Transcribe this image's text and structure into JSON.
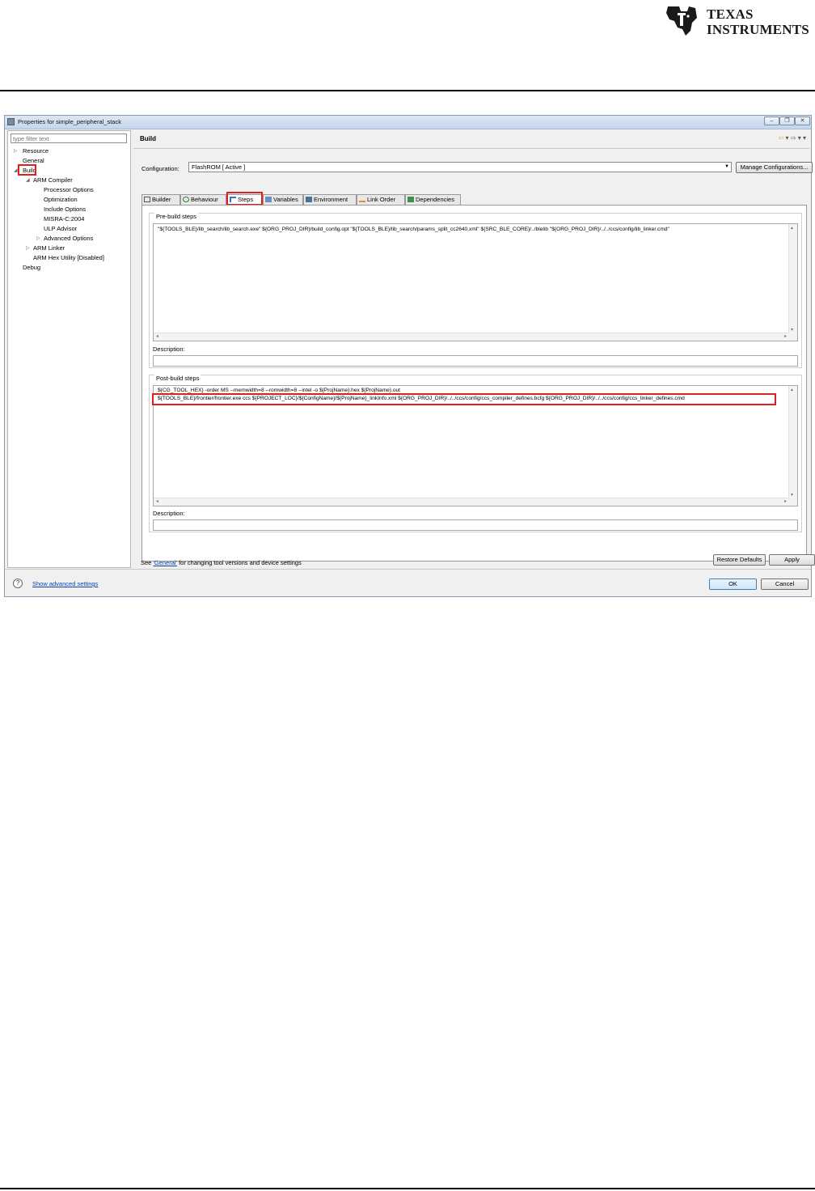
{
  "doc_header": {
    "brand_line1": "TEXAS",
    "brand_line2": "INSTRUMENTS"
  },
  "window": {
    "title": "Properties for simple_peripheral_stack",
    "minimize": "–",
    "restore": "❐",
    "close": "✕"
  },
  "sidebar": {
    "filter_placeholder": "type filter text",
    "items": [
      {
        "label": "Resource"
      },
      {
        "label": "General"
      },
      {
        "label": "Build"
      },
      {
        "label": "ARM Compiler"
      },
      {
        "label": "Processor Options"
      },
      {
        "label": "Optimization"
      },
      {
        "label": "Include Options"
      },
      {
        "label": "MISRA-C:2004"
      },
      {
        "label": "ULP Advisor"
      },
      {
        "label": "Advanced Options"
      },
      {
        "label": "ARM Linker"
      },
      {
        "label": "ARM Hex Utility  [Disabled]"
      },
      {
        "label": "Debug"
      }
    ],
    "selected": "Build"
  },
  "main": {
    "title": "Build",
    "nav": {
      "back": "⇦",
      "dropdown": "▾",
      "forward": "⇨",
      "menu": "▾"
    },
    "configuration_label": "Configuration:",
    "configuration_value": "FlashROM  [ Active ]",
    "manage_button": "Manage Configurations...",
    "tabs": [
      {
        "label": "Builder",
        "icon": "builder-icon"
      },
      {
        "label": "Behaviour",
        "icon": "behaviour-icon"
      },
      {
        "label": "Steps",
        "icon": "steps-icon"
      },
      {
        "label": "Variables",
        "icon": "variables-icon"
      },
      {
        "label": "Environment",
        "icon": "environment-icon"
      },
      {
        "label": "Link Order",
        "icon": "link-order-icon"
      },
      {
        "label": "Dependencies",
        "icon": "dependencies-icon"
      }
    ],
    "active_tab": "Steps",
    "prebuild": {
      "label": "Pre-build steps",
      "lines": [
        "\"${TOOLS_BLE}/lib_search/lib_search.exe\" ${ORG_PROJ_DIR}/build_config.opt \"${TOOLS_BLE}/lib_search/params_split_cc2640.xml\" ${SRC_BLE_CORE}/../blelib \"${ORG_PROJ_DIR}/../../ccs/config/lib_linker.cmd\""
      ],
      "description_label": "Description:",
      "description_value": ""
    },
    "postbuild": {
      "label": "Post-build steps",
      "lines": [
        "${CG_TOOL_HEX} -order MS --memwidth=8 --romwidth=8 --intel -o ${ProjName}.hex ${ProjName}.out",
        "${TOOLS_BLE}/frontier/frontier.exe ccs ${PROJECT_LOC}/${ConfigName}/${ProjName}_linkInfo.xml ${ORG_PROJ_DIR}/../../ccs/config/ccs_compiler_defines.bcfg ${ORG_PROJ_DIR}/../../ccs/config/ccs_linker_defines.cmd"
      ],
      "description_label": "Description:",
      "description_value": ""
    },
    "see_prefix": "See ",
    "see_link": "'General'",
    "see_suffix": " for changing tool versions and device settings",
    "restore_defaults": "Restore Defaults",
    "apply": "Apply"
  },
  "footer": {
    "help": "?",
    "advanced_link": "Show advanced settings",
    "ok": "OK",
    "cancel": "Cancel"
  },
  "colors": {
    "highlight": "#e02020",
    "link": "#0645ad",
    "ok_focus": "#3c7fb1"
  }
}
